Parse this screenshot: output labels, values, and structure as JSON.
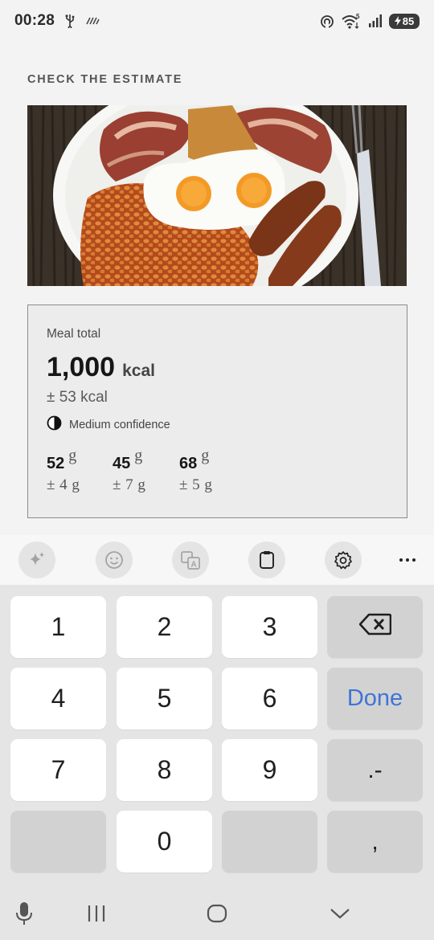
{
  "status_bar": {
    "time": "00:28",
    "battery_level": "85",
    "icons": [
      "usb-icon",
      "vibrate-icon",
      "nfc-icon",
      "wifi-icon",
      "signal-icon",
      "battery-charging-icon"
    ]
  },
  "screen": {
    "title": "CHECK THE ESTIMATE",
    "photo": {
      "description_icon": "meal-photo"
    }
  },
  "estimate": {
    "label": "Meal total",
    "kcal_value": "1,000",
    "kcal_unit": "kcal",
    "kcal_range": "± 53 kcal",
    "confidence": "Medium confidence",
    "macros": [
      {
        "value": "52",
        "unit": "g",
        "range": "± 4 g"
      },
      {
        "value": "45",
        "unit": "g",
        "range": "± 7 g"
      },
      {
        "value": "68",
        "unit": "g",
        "range": "± 5 g"
      }
    ]
  },
  "keyboard_toolbar": {
    "items": [
      "ai-sparkle-icon",
      "emoji-icon",
      "translate-icon",
      "clipboard-icon",
      "settings-icon",
      "more-icon"
    ]
  },
  "keyboard": {
    "keys": {
      "k1": "1",
      "k2": "2",
      "k3": "3",
      "k4": "4",
      "k5": "5",
      "k6": "6",
      "k7": "7",
      "k8": "8",
      "k9": "9",
      "k0": "0",
      "done": "Done",
      "dot_minus": ".-",
      "comma": ","
    }
  },
  "colors": {
    "accent": "#3f74d6",
    "background": "#f3f3f3",
    "keyboard_bg": "#e5e5e5"
  }
}
